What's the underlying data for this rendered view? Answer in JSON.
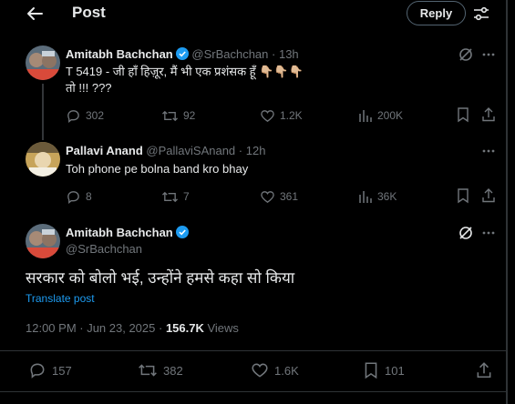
{
  "header": {
    "title": "Post",
    "reply_label": "Reply"
  },
  "thread": [
    {
      "author": "Amitabh Bachchan",
      "handle": "@SrBachchan",
      "time": "· 13h",
      "text_line1": "T 5419 - जी हाँ हिज़ूर, मैं भी एक प्रशंसक हूँ  👇🏼👇🏼👇🏼",
      "text_line2": "तो !!! ???",
      "replies": "302",
      "reposts": "92",
      "likes": "1.2K",
      "views": "200K"
    },
    {
      "author": "Pallavi Anand",
      "handle": "@PallaviSAnand",
      "time": "· 12h",
      "text_line1": "Toh phone pe bolna band kro bhay",
      "replies": "8",
      "reposts": "7",
      "likes": "361",
      "views": "36K"
    }
  ],
  "main_post": {
    "author": "Amitabh Bachchan",
    "handle": "@SrBachchan",
    "text": "सरकार को बोलो भई, उन्होंने हमसे कहा सो किया",
    "translate_label": "Translate post",
    "timestamp": "12:00 PM · Jun 23, 2025 · ",
    "views_count": "156.7K",
    "views_label": "Views",
    "replies": "157",
    "reposts": "382",
    "likes": "1.6K",
    "bookmarks": "101"
  },
  "colors": {
    "background": "#000000",
    "text": "#e7e9ea",
    "muted": "#71767b",
    "accent": "#1d9bf0",
    "divider": "#2f3336"
  },
  "icons": [
    "back-arrow-icon",
    "filter-icon",
    "verified-badge-icon",
    "grok-icon",
    "more-icon",
    "reply-icon",
    "repost-icon",
    "like-icon",
    "views-icon",
    "bookmark-icon",
    "share-icon"
  ]
}
